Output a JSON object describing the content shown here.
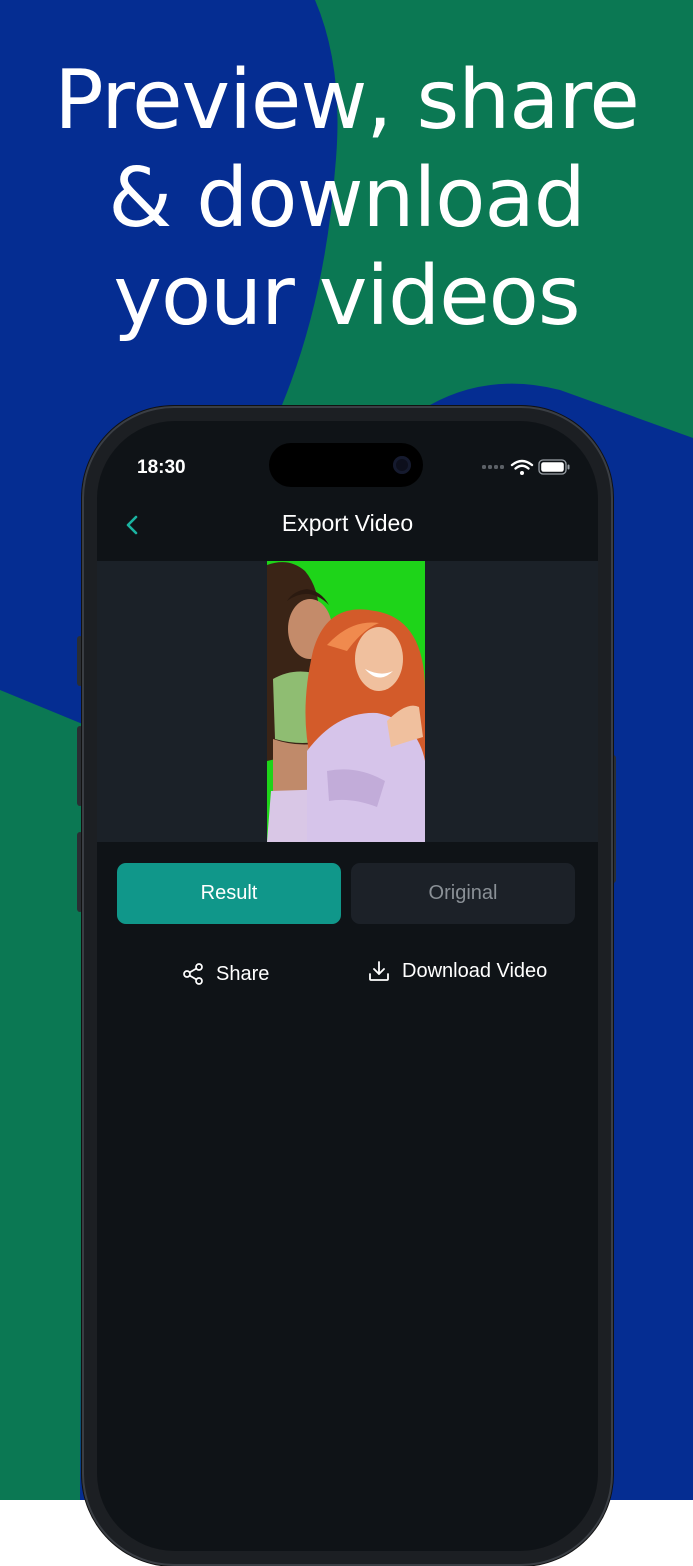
{
  "headline": {
    "line1": "Preview, share",
    "line2": "& download",
    "line3": "your videos"
  },
  "colors": {
    "bg_blue": "#052d92",
    "bg_green": "#0b7853",
    "accent": "#10978a",
    "screen_bg": "#0f1317"
  },
  "status_bar": {
    "time": "18:30",
    "icons": [
      "cellular-icon",
      "wifi-icon",
      "battery-icon"
    ]
  },
  "nav": {
    "back_icon": "chevron-left-icon",
    "title": "Export Video"
  },
  "tabs": {
    "result_label": "Result",
    "original_label": "Original",
    "selected": "Result"
  },
  "actions": {
    "share_label": "Share",
    "share_icon": "share-icon",
    "download_label": "Download Video",
    "download_icon": "download-icon"
  }
}
